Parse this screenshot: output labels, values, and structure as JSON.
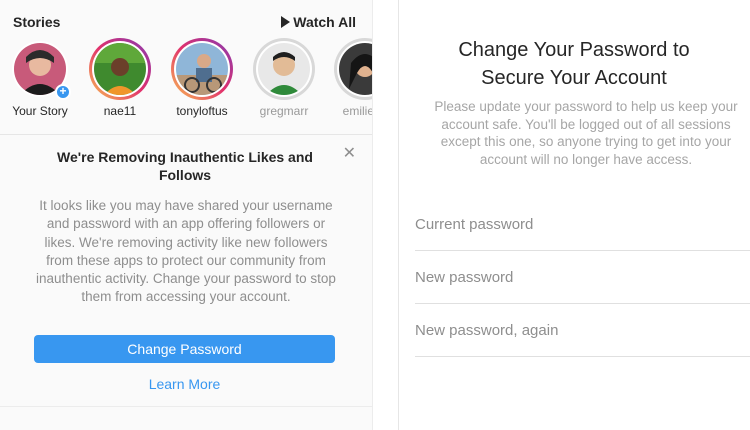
{
  "stories": {
    "title": "Stories",
    "watch_all": "Watch All",
    "items": [
      {
        "label": "Your Story",
        "state": "own"
      },
      {
        "label": "nae11",
        "state": "active"
      },
      {
        "label": "tonyloftus",
        "state": "active"
      },
      {
        "label": "gregmarr",
        "state": "seen"
      },
      {
        "label": "emilie.ta",
        "state": "seen"
      }
    ]
  },
  "notice": {
    "title": "We're Removing Inauthentic Likes and Follows",
    "body": "It looks like you may have shared your username and password with an app offering followers or likes. We're removing activity like new followers from these apps to protect our community from inauthentic activity. Change your password to stop them from accessing your account.",
    "primary_button": "Change Password",
    "secondary_link": "Learn More",
    "close_icon": "close-icon"
  },
  "change_password": {
    "title": "Change Your Password to Secure Your Account",
    "description": "Please update your password to help us keep your account safe. You'll be logged out of all sessions except this one, so anyone trying to get into your account will no longer have access.",
    "fields": [
      {
        "placeholder": "Current password"
      },
      {
        "placeholder": "New password"
      },
      {
        "placeholder": "New password, again"
      }
    ]
  },
  "colors": {
    "accent": "#3897f0",
    "text": "#262626",
    "muted": "#8e8e8e"
  }
}
